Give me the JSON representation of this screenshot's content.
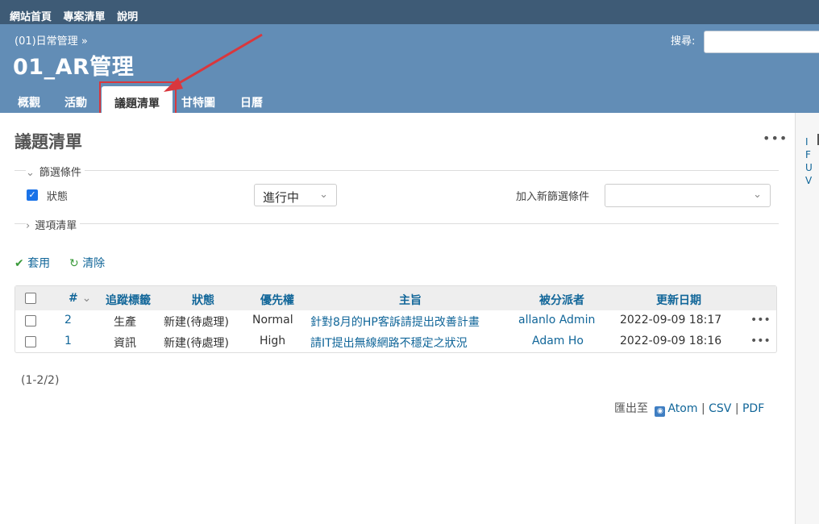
{
  "top_menu": {
    "home": "網站首頁",
    "projects": "專案清單",
    "help": "說明"
  },
  "header": {
    "breadcrumb": "(01)日常管理 »",
    "project_title": "01_AR管理",
    "search_label": "搜尋:"
  },
  "tabs": [
    {
      "label": "概觀"
    },
    {
      "label": "活動"
    },
    {
      "label": "議題清單",
      "selected": true
    },
    {
      "label": "甘特圖"
    },
    {
      "label": "日曆"
    }
  ],
  "page": {
    "title": "議題清單",
    "context_menu": "•••"
  },
  "filters": {
    "legend": "篩選條件",
    "status_label": "狀態",
    "status_operator": "進行中",
    "add_filter_label": "加入新篩選條件",
    "add_filter_value": ""
  },
  "options": {
    "legend": "選項清單"
  },
  "actions": {
    "apply": "套用",
    "clear": "清除"
  },
  "table": {
    "columns": [
      "#",
      "追蹤標籤",
      "狀態",
      "優先權",
      "主旨",
      "被分派者",
      "更新日期"
    ],
    "rows": [
      {
        "id": "2",
        "tracker": "生產",
        "status": "新建(待處理)",
        "priority": "Normal",
        "subject": "針對8月的HP客訴請提出改善計畫",
        "assignee": "allanlo Admin",
        "updated": "2022-09-09 18:17"
      },
      {
        "id": "1",
        "tracker": "資訊",
        "status": "新建(待處理)",
        "priority": "High",
        "subject": "請IT提出無線網路不穩定之狀況",
        "assignee": "Adam Ho",
        "updated": "2022-09-09 18:16"
      }
    ]
  },
  "pagination": "(1-2/2)",
  "export": {
    "label": "匯出至",
    "atom": "Atom",
    "csv": "CSV",
    "pdf": "PDF",
    "sep": "|"
  },
  "sidebar": {
    "letters": [
      "I",
      "F",
      "U",
      "V"
    ]
  },
  "colors": {
    "top_menu_bg": "#3e5b76",
    "header_bg": "#628db6",
    "link": "#116699",
    "annotation_red": "#d9373d"
  }
}
